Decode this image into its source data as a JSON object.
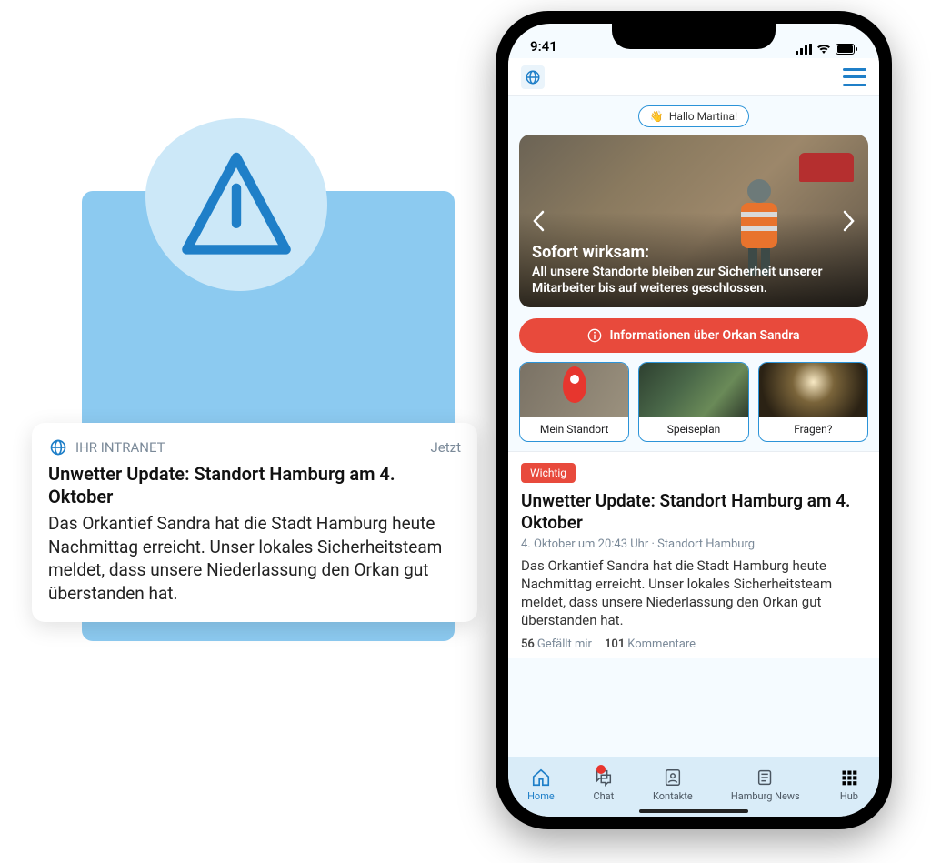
{
  "colors": {
    "accent": "#1f7fc8",
    "danger": "#e84a3c"
  },
  "push": {
    "app_name": "IHR INTRANET",
    "time": "Jetzt",
    "title": "Unwetter Update: Standort Hamburg am 4. Oktober",
    "body": "Das Orkantief Sandra hat die Stadt Hamburg heute Nachmittag erreicht. Unser lokales Sicherheitsteam meldet, dass unsere Niederlassung den Orkan gut überstanden hat."
  },
  "status": {
    "time": "9:41"
  },
  "greeting": {
    "emoji": "👋",
    "text": "Hallo Martina!"
  },
  "hero": {
    "title": "Sofort wirksam:",
    "subtitle": "All unsere Standorte bleiben zur Sicherheit unserer Mitarbeiter bis auf weiteres geschlossen."
  },
  "info_button": "Informationen über Orkan Sandra",
  "tiles": [
    {
      "label": "Mein Standort"
    },
    {
      "label": "Speiseplan"
    },
    {
      "label": "Fragen?"
    }
  ],
  "news": {
    "badge": "Wichtig",
    "title": "Unwetter Update: Standort Hamburg am 4. Oktober",
    "meta": "4. Oktober um 20:43 Uhr · Standort Hamburg",
    "body": "Das Orkantief Sandra hat die Stadt Hamburg heute Nachmittag erreicht. Unser lokales Sicherheitsteam meldet, dass unsere Niederlassung den Orkan gut überstanden hat.",
    "likes_count": "56",
    "likes_label": "Gefällt mir",
    "comments_count": "101",
    "comments_label": "Kommentare"
  },
  "nav": {
    "items": [
      {
        "label": "Home"
      },
      {
        "label": "Chat"
      },
      {
        "label": "Kontakte"
      },
      {
        "label": "Hamburg News"
      },
      {
        "label": "Hub"
      }
    ]
  }
}
